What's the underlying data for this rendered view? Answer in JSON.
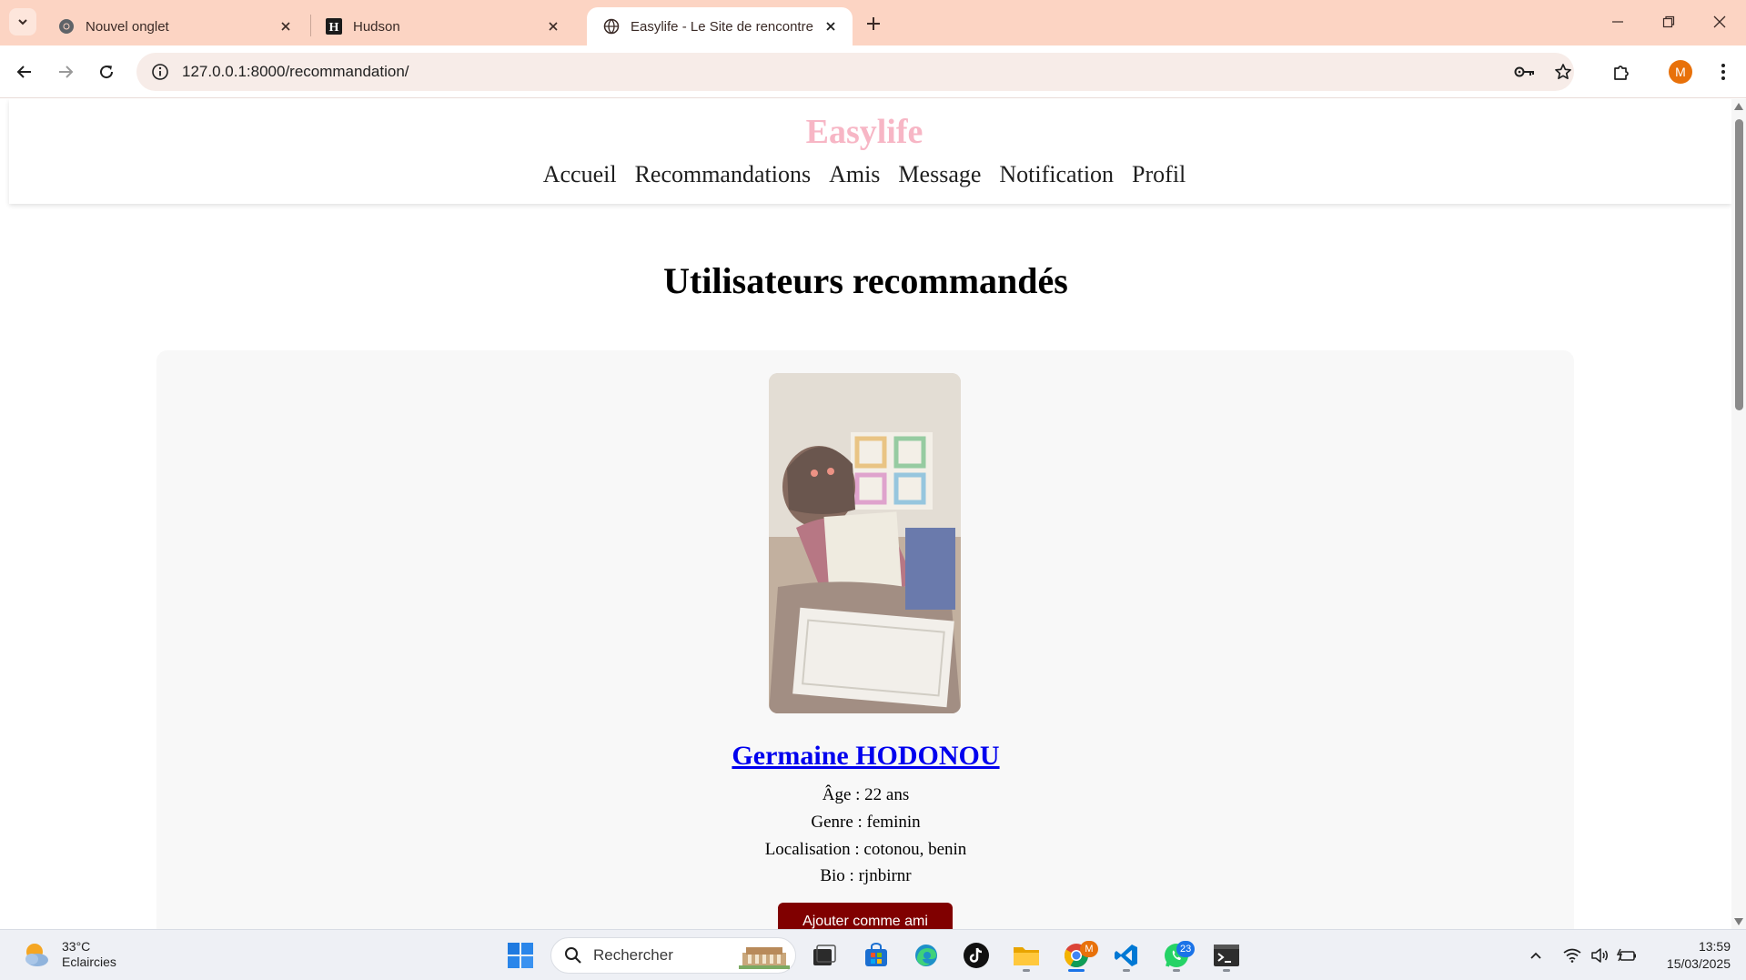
{
  "browser": {
    "tabs": [
      {
        "title": "Nouvel onglet",
        "favicon": "chrome-icon",
        "active": false
      },
      {
        "title": "Hudson",
        "favicon": "h-icon",
        "active": false
      },
      {
        "title": "Easylife - Le Site de rencontre",
        "favicon": "globe-icon",
        "active": true
      }
    ],
    "url": "127.0.0.1:8000/recommandation/",
    "profile_initial": "M"
  },
  "site": {
    "logo": "Easylife",
    "logo_color": "#f7b6c5",
    "nav": [
      "Accueil",
      "Recommandations",
      "Amis",
      "Message",
      "Notification",
      "Profil"
    ]
  },
  "page": {
    "title": "Utilisateurs recommandés",
    "user": {
      "name": "Germaine HODONOU",
      "age": "Âge : 22 ans",
      "genre": "Genre : feminin",
      "localisation": "Localisation : cotonou, benin",
      "bio": "Bio : rjnbirnr",
      "button_label": "Ajouter comme ami",
      "button_color": "#800000"
    }
  },
  "taskbar": {
    "weather_temp": "33°C",
    "weather_desc": "Eclaircies",
    "search_placeholder": "Rechercher",
    "whatsapp_badge": "23",
    "chrome_badge": "M",
    "time": "13:59",
    "date": "15/03/2025"
  }
}
